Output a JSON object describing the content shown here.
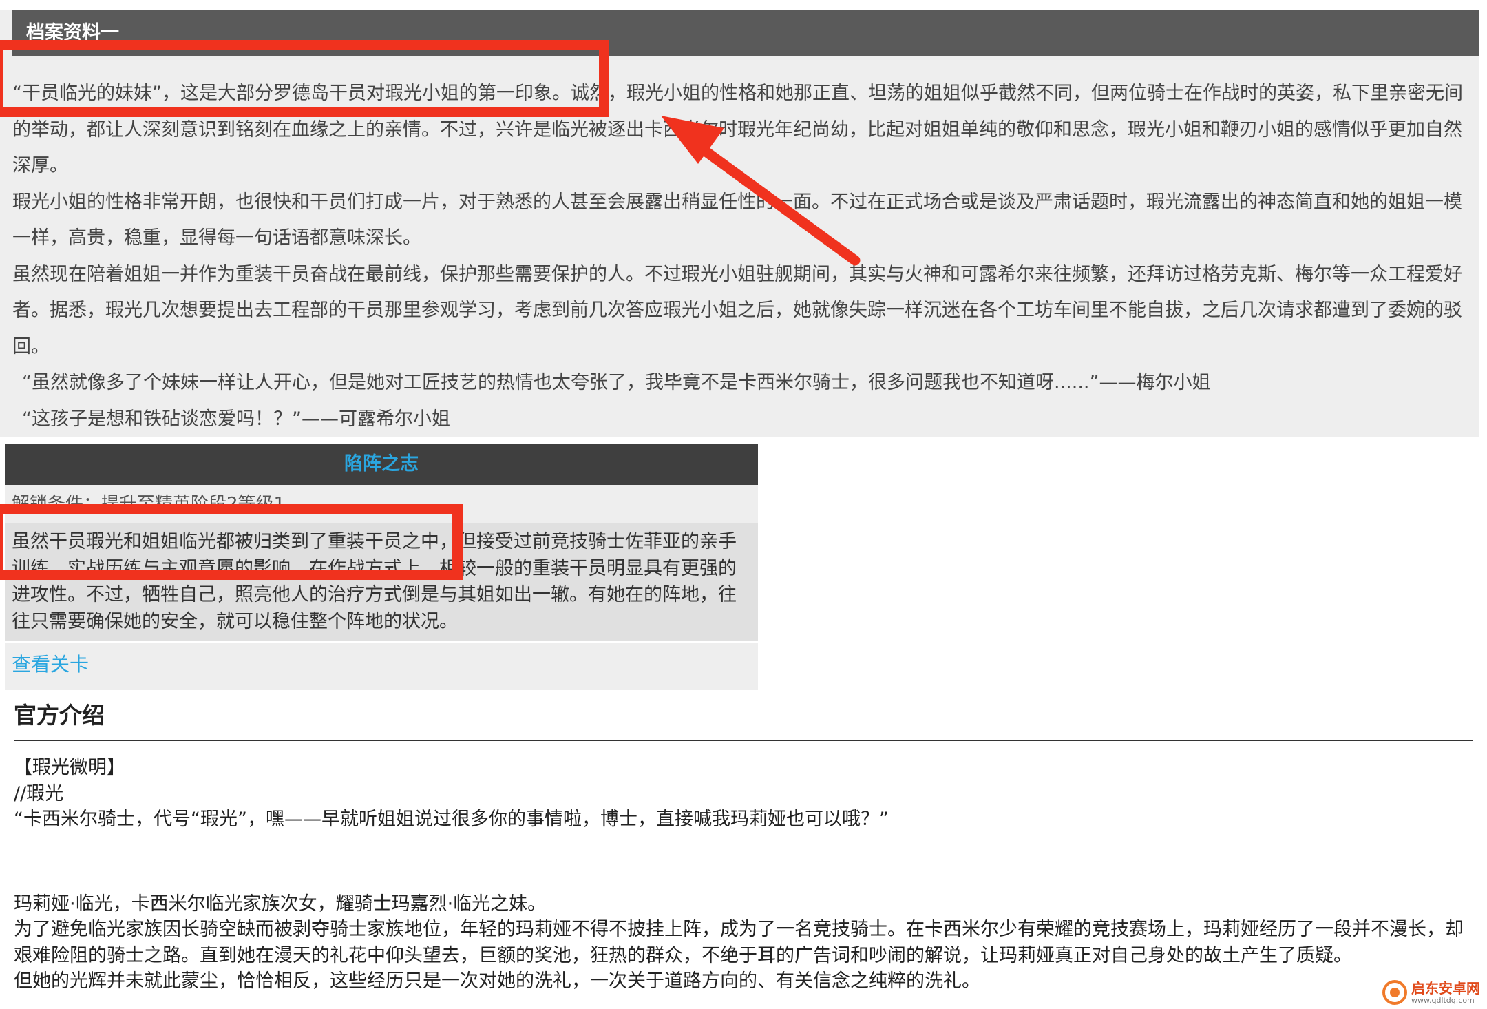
{
  "archive": {
    "header": "档案资料一",
    "paragraphs": [
      "“干员临光的妹妹”，这是大部分罗德岛干员对瑕光小姐的第一印象。诚然，瑕光小姐的性格和她那正直、坦荡的姐姐似乎截然不同，但两位骑士在作战时的英姿，私下里亲密无间的举动，都让人深刻意识到铭刻在血缘之上的亲情。不过，兴许是临光被逐出卡西米尔时瑕光年纪尚幼，比起对姐姐单纯的敬仰和思念，瑕光小姐和鞭刃小姐的感情似乎更加自然深厚。",
      "瑕光小姐的性格非常开朗，也很快和干员们打成一片，对于熟悉的人甚至会展露出稍显任性的一面。不过在正式场合或是谈及严肃话题时，瑕光流露出的神态简直和她的姐姐一模一样，高贵，稳重，显得每一句话语都意味深长。",
      "虽然现在陪着姐姐一并作为重装干员奋战在最前线，保护那些需要保护的人。不过瑕光小姐驻舰期间，其实与火神和可露希尔来往频繁，还拜访过格劳克斯、梅尔等一众工程爱好者。据悉，瑕光几次想要提出去工程部的干员那里参观学习，考虑到前几次答应瑕光小姐之后，她就像失踪一样沉迷在各个工坊车间里不能自拔，之后几次请求都遭到了委婉的驳回。"
    ],
    "quotes": [
      "“虽然就像多了个妹妹一样让人开心，但是她对工匠技艺的热情也太夸张了，我毕竟不是卡西米尔骑士，很多问题我也不知道呀......”——梅尔小姐",
      "“这孩子是想和铁砧谈恋爱吗！？”——可露希尔小姐"
    ]
  },
  "potential": {
    "title": "陷阵之志",
    "unlock": "解锁条件：提升至精英阶段2等级1",
    "description": "虽然干员瑕光和姐姐临光都被归类到了重装干员之中，但接受过前竞技骑士佐菲亚的亲手训练，实战历练与主观意愿的影响，在作战方式上，相较一般的重装干员明显具有更强的进攻性。不过，牺牲自己，照亮他人的治疗方式倒是与其姐如出一辙。有她在的阵地，往往只需要确保她的安全，就可以稳住整个阵地的状况。",
    "link": "查看关卡"
  },
  "official": {
    "title": "官方介绍",
    "lines": [
      "【瑕光微明】",
      "//瑕光",
      "“卡西米尔骑士，代号“瑕光”，嘿——早就听姐姐说过很多你的事情啦，博士，直接喊我玛莉娅也可以哦？”"
    ],
    "paragraphs": [
      "玛莉娅·临光，卡西米尔临光家族次女，耀骑士玛嘉烈·临光之妹。",
      "为了避免临光家族因长骑空缺而被剥夺骑士家族地位，年轻的玛莉娅不得不披挂上阵，成为了一名竞技骑士。在卡西米尔少有荣耀的竞技赛场上，玛莉娅经历了一段并不漫长，却艰难险阻的骑士之路。直到她在漫天的礼花中仰头望去，巨额的奖池，狂热的群众，不绝于耳的广告词和吵闹的解说，让玛莉娅真正对自己身处的故土产生了质疑。",
      "但她的光辉并未就此蒙尘，恰恰相反，这些经历只是一次对她的洗礼，一次关于道路方向的、有关信念之纯粹的洗礼。"
    ]
  },
  "annotations": {
    "color": "#f0321e"
  },
  "watermark": {
    "name": "启东安卓网",
    "url": "www.qdltdq.com"
  }
}
